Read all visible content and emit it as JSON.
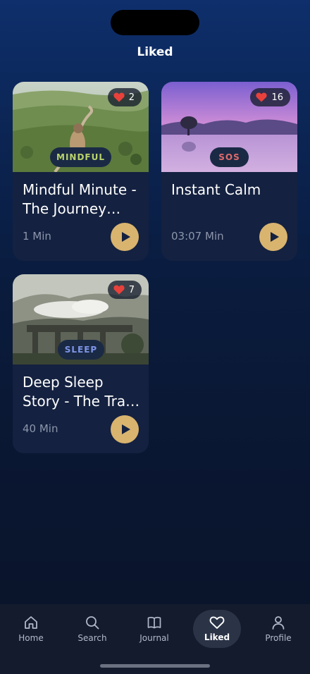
{
  "header": {
    "title": "Liked"
  },
  "colors": {
    "accent_gold": "#d9b46f",
    "heart_red": "#e8413b",
    "mindful_tag": "#b9d36a",
    "sos_tag": "#e06b6b",
    "sleep_tag": "#7f95e8"
  },
  "cards": [
    {
      "title": "Mindful Minute - The Journey Within",
      "tag": "MINDFUL",
      "likes": "2",
      "duration": "1 Min",
      "play_icon": "play-icon",
      "like_icon": "heart-icon"
    },
    {
      "title": "Instant Calm",
      "tag": "SOS",
      "likes": "16",
      "duration": "03:07 Min",
      "play_icon": "play-icon",
      "like_icon": "heart-icon"
    },
    {
      "title": "Deep Sleep Story - The Train Journey",
      "tag": "SLEEP",
      "likes": "7",
      "duration": "40 Min",
      "play_icon": "play-icon",
      "like_icon": "heart-icon"
    }
  ],
  "tabbar": {
    "items": [
      {
        "label": "Home",
        "icon": "home-icon",
        "active": false
      },
      {
        "label": "Search",
        "icon": "search-icon",
        "active": false
      },
      {
        "label": "Journal",
        "icon": "book-icon",
        "active": false
      },
      {
        "label": "Liked",
        "icon": "heart-icon",
        "active": true
      },
      {
        "label": "Profile",
        "icon": "user-icon",
        "active": false
      }
    ]
  }
}
